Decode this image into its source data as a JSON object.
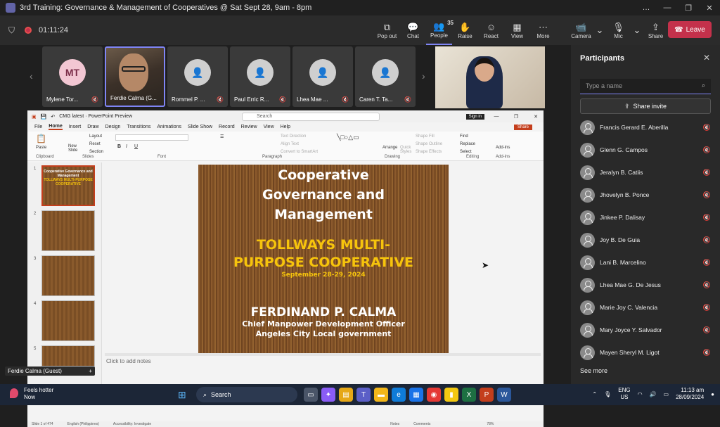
{
  "window": {
    "title": "3rd Training: Governance & Management of Cooperatives @ Sat Sept 28, 9am - 8pm",
    "controls": [
      "…",
      "—",
      "❐",
      "✕"
    ]
  },
  "meeting": {
    "timer": "01:11:24",
    "tools": [
      {
        "label": "Pop out",
        "icon": "pop-out-icon"
      },
      {
        "label": "Chat",
        "icon": "chat-icon"
      },
      {
        "label": "People",
        "icon": "people-icon",
        "count": "35",
        "active": true
      },
      {
        "label": "Raise",
        "icon": "raise-hand-icon"
      },
      {
        "label": "React",
        "icon": "react-icon"
      },
      {
        "label": "View",
        "icon": "view-icon"
      },
      {
        "label": "More",
        "icon": "more-icon"
      }
    ],
    "camera_label": "Camera",
    "mic_label": "Mic",
    "share_label": "Share",
    "leave_label": "Leave"
  },
  "tiles": [
    {
      "name": "Mylene Tor...",
      "initials": "MT"
    },
    {
      "name": "Ferdie Calma (G...",
      "video": true
    },
    {
      "name": "Rommel P. ..."
    },
    {
      "name": "Paul Erric R..."
    },
    {
      "name": "Lhea Mae ..."
    },
    {
      "name": "Caren T. Ta..."
    }
  ],
  "ppt": {
    "file": "CMG latest  ·  PowerPoint Preview",
    "search": "Search",
    "signin": "Sign in",
    "menus": [
      "File",
      "Home",
      "Insert",
      "Draw",
      "Design",
      "Transitions",
      "Animations",
      "Slide Show",
      "Record",
      "Review",
      "View",
      "Help"
    ],
    "share": "Share",
    "ribbon": {
      "groups": [
        "Clipboard",
        "Slides",
        "Font",
        "Paragraph",
        "Drawing",
        "Editing",
        "Add-ins"
      ],
      "paste": "Paste",
      "new_slide": "New Slide",
      "layout": "Layout",
      "reset": "Reset",
      "section": "Section",
      "text_direction": "Text Direction",
      "align_text": "Align Text",
      "convert_smartart": "Convert to SmartArt",
      "arrange": "Arrange",
      "quick_styles": "Quick Styles",
      "shape_fill": "Shape Fill",
      "shape_outline": "Shape Outline",
      "shape_effects": "Shape Effects",
      "find": "Find",
      "replace": "Replace",
      "select": "Select",
      "addins": "Add-ins"
    },
    "thumbs": [
      {
        "num": "1",
        "title": "Cooperative Governance and Management",
        "yellow": "TOLLWAYS MULTI-PURPOSE COOPERATIVE"
      },
      {
        "num": "2",
        "title": "",
        "yellow": ""
      },
      {
        "num": "3",
        "title": "",
        "yellow": ""
      },
      {
        "num": "4",
        "title": "",
        "yellow": ""
      },
      {
        "num": "5",
        "title": "",
        "yellow": ""
      }
    ],
    "slide": {
      "title": [
        "Cooperative",
        "Governance and",
        "Management"
      ],
      "coop": [
        "TOLLWAYS MULTI-",
        "PURPOSE COOPERATIVE"
      ],
      "date": "September 28-29, 2024",
      "name": "FERDINAND   P. CALMA",
      "role": "Chief Manpower Development Officer",
      "org": "Angeles City Local government"
    },
    "notes": "Click to add notes",
    "status": {
      "slide": "Slide 1 of 474",
      "lang": "English (Philippines)",
      "access": "Accessibility: Investigate",
      "notes": "Notes",
      "comments": "Comments",
      "zoom": "78%"
    }
  },
  "self_label": "Ferdie Calma (Guest)",
  "participants": {
    "title": "Participants",
    "search_placeholder": "Type a name",
    "share_invite": "Share invite",
    "list": [
      "Francis Gerard E. Aberilla",
      "Glenn G. Campos",
      "Jeralyn B. Catiis",
      "Jhovelyn B. Ponce",
      "Jinkee P. Dalisay",
      "Joy B. De Guia",
      "Lani B. Marcelino",
      "Lhea Mae G. De Jesus",
      "Marie Joy C. Valencia",
      "Mary Joyce Y. Salvador",
      "Mayen Sheryl M. Ligot"
    ],
    "see_more": "See more"
  },
  "taskbar": {
    "weather_title": "Feels hotter",
    "weather_sub": "Now",
    "search": "Search",
    "lang1": "ENG",
    "lang2": "US",
    "time": "11:13 am",
    "date": "28/09/2024"
  }
}
